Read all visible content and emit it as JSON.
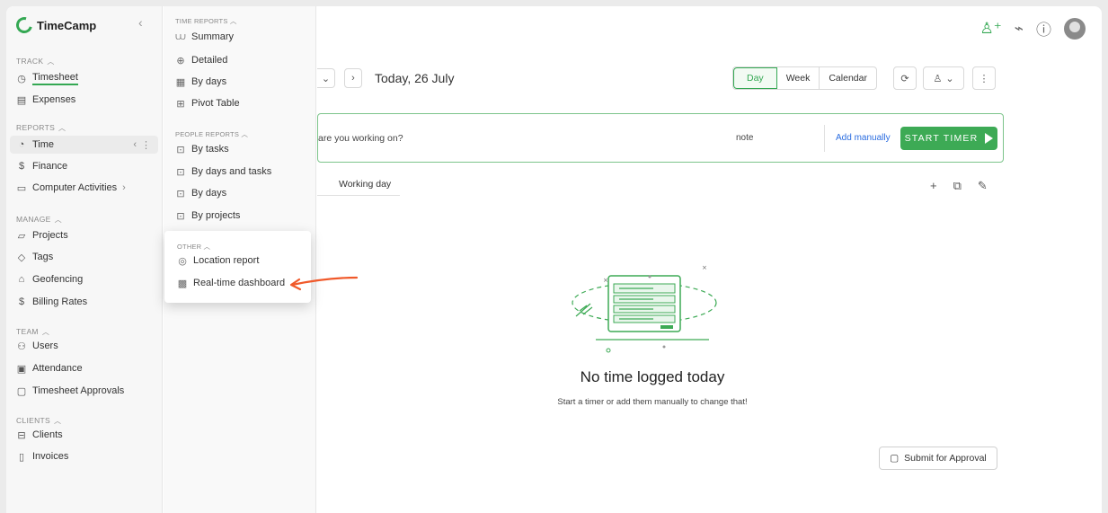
{
  "app": {
    "name": "TimeCamp",
    "accent": "#34a853",
    "link_color": "#2b6de0"
  },
  "sidebar": {
    "sections": [
      {
        "label": "TRACK",
        "items": [
          {
            "label": "Timesheet",
            "icon": "clock-icon"
          },
          {
            "label": "Expenses",
            "icon": "receipt-icon"
          }
        ]
      },
      {
        "label": "REPORTS",
        "items": [
          {
            "label": "Time",
            "icon": "chart-icon"
          },
          {
            "label": "Finance",
            "icon": "dollar-icon"
          },
          {
            "label": "Computer Activities",
            "icon": "monitor-icon"
          }
        ]
      },
      {
        "label": "MANAGE",
        "items": [
          {
            "label": "Projects",
            "icon": "folder-icon"
          },
          {
            "label": "Tags",
            "icon": "tag-icon"
          },
          {
            "label": "Geofencing",
            "icon": "geofence-icon"
          },
          {
            "label": "Billing Rates",
            "icon": "dollar-icon"
          }
        ]
      },
      {
        "label": "TEAM",
        "items": [
          {
            "label": "Users",
            "icon": "users-icon"
          },
          {
            "label": "Attendance",
            "icon": "attendance-icon"
          },
          {
            "label": "Timesheet Approvals",
            "icon": "approvals-icon"
          }
        ]
      },
      {
        "label": "CLIENTS",
        "items": [
          {
            "label": "Clients",
            "icon": "briefcase-icon"
          },
          {
            "label": "Invoices",
            "icon": "invoice-icon"
          }
        ]
      }
    ]
  },
  "submenu": {
    "time_reports": {
      "label": "TIME REPORTS",
      "items": [
        {
          "label": "Summary",
          "icon": "summary-icon"
        },
        {
          "label": "Detailed",
          "icon": "magnifier-icon"
        },
        {
          "label": "By days",
          "icon": "calendar-grid-icon"
        },
        {
          "label": "Pivot Table",
          "icon": "pivot-table-icon"
        }
      ]
    },
    "people_reports": {
      "label": "PEOPLE REPORTS",
      "items": [
        {
          "label": "By tasks",
          "icon": "people-report-icon"
        },
        {
          "label": "By days and tasks",
          "icon": "people-report-icon"
        },
        {
          "label": "By days",
          "icon": "people-report-icon"
        },
        {
          "label": "By projects",
          "icon": "people-report-icon"
        }
      ]
    },
    "other": {
      "label": "OTHER",
      "items": [
        {
          "label": "Location report",
          "icon": "location-pin-icon"
        },
        {
          "label": "Real-time dashboard",
          "icon": "dashboard-icon"
        }
      ]
    }
  },
  "header": {
    "date_label": "Today, 26 July",
    "views": [
      "Day",
      "Week",
      "Calendar"
    ],
    "active_view": "Day"
  },
  "timer": {
    "placeholder": "are you working on?",
    "note_label": "note",
    "add_manually": "Add manually",
    "start_label": "START TIMER"
  },
  "entries": {
    "working_day_label": "Working day"
  },
  "empty_state": {
    "title": "No time logged today",
    "subtitle": "Start a timer or add them manually to change that!"
  },
  "footer": {
    "submit_label": "Submit for Approval"
  }
}
